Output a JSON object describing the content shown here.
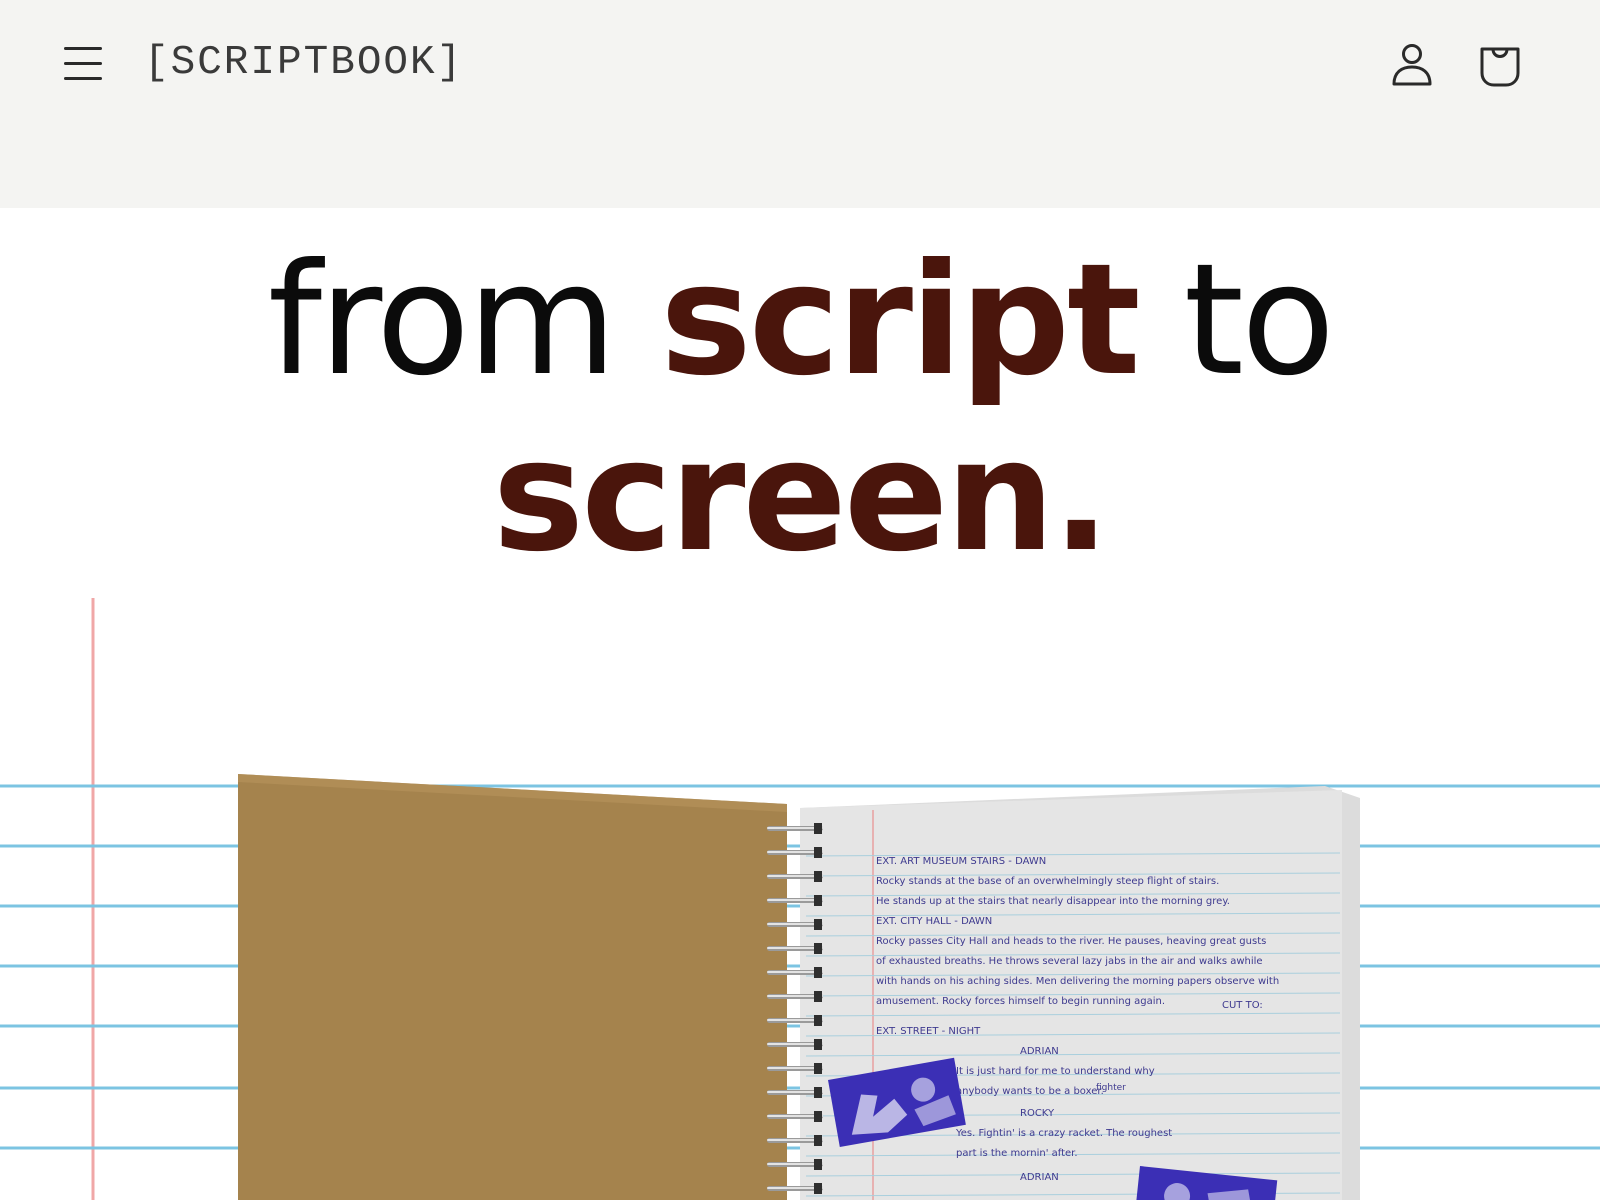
{
  "header": {
    "brand": "[SCRIPTBOOK]",
    "menu_icon": "hamburger-menu-icon",
    "account_icon": "user-account-icon",
    "cart_icon": "shopping-bag-icon"
  },
  "hero": {
    "word_from": "from",
    "word_script": "script",
    "word_to": "to",
    "line2": "screen."
  },
  "notebook": {
    "page_lines": [
      "EXT. ART MUSEUM STAIRS - DAWN",
      "Rocky stands at the base of an overwhelmingly steep flight of stairs.",
      "He stands up at the stairs that nearly disappear into the morning grey.",
      "EXT. CITY HALL - DAWN",
      "Rocky passes City Hall and heads to the river. He pauses, heaving great gusts",
      "of exhausted breaths. He throws several lazy jabs in the air and walks awhile",
      "with hands on his aching sides. Men delivering the morning papers observe with",
      "amusement. Rocky forces himself to begin running again.",
      "CUT TO:",
      "EXT. STREET - NIGHT",
      "ADRIAN",
      "It is just hard for me to understand why",
      "anybody wants to be a boxer.",
      "fighter",
      "ROCKY",
      "Yes. Fightin' is a crazy racket. The roughest",
      "part is the mornin' after.",
      "ADRIAN"
    ]
  },
  "colors": {
    "header_bg": "#f4f4f2",
    "accent": "#4a150c",
    "text": "#0b0b0b",
    "rule_blue": "#7cc4e2",
    "margin_red": "#f0a7a7",
    "kraft": "#a5834d",
    "ink_purple": "#3b2fb5"
  }
}
